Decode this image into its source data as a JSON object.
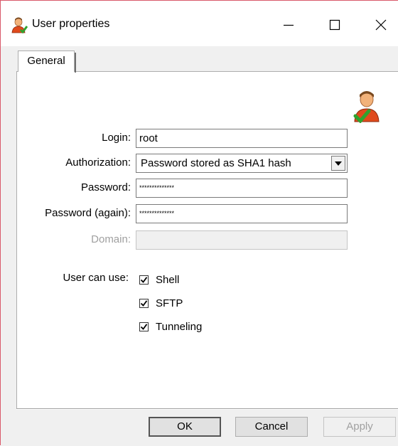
{
  "window": {
    "title": "User properties"
  },
  "title_buttons": {
    "minimize": "—",
    "maximize": "☐",
    "close": "✕"
  },
  "tabs": [
    {
      "label": "General"
    }
  ],
  "form": {
    "login": {
      "label": "Login:",
      "value": "root"
    },
    "authorization": {
      "label": "Authorization:",
      "value": "Password stored as SHA1 hash"
    },
    "password": {
      "label": "Password:",
      "value": "**************"
    },
    "password_again": {
      "label": "Password (again):",
      "value": "**************"
    },
    "domain": {
      "label": "Domain:",
      "value": ""
    },
    "user_can_use": {
      "label": "User can use:",
      "options": [
        {
          "label": "Shell",
          "checked": true
        },
        {
          "label": "SFTP",
          "checked": true
        },
        {
          "label": "Tunneling",
          "checked": true
        }
      ]
    }
  },
  "buttons": {
    "ok": "OK",
    "cancel": "Cancel",
    "apply": "Apply"
  },
  "colors": {
    "window_border": "#d9596a",
    "dialog_bg": "#f0f0f0",
    "user_icon_shirt": "#e04a1c",
    "check_green": "#2fa32f"
  }
}
